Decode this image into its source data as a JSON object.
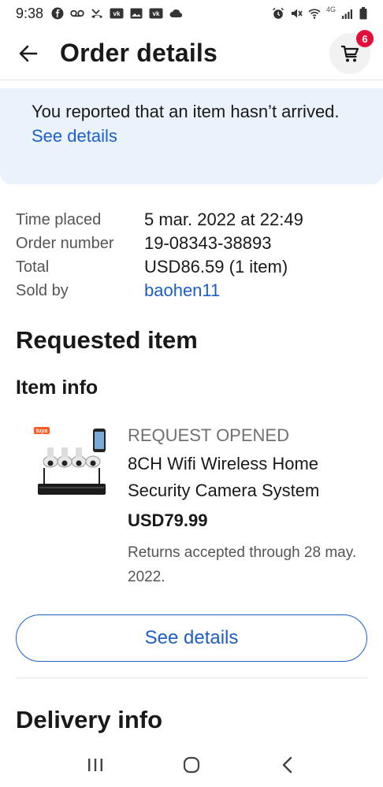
{
  "status_bar": {
    "time": "9:38",
    "left_icons": [
      "facebook-icon",
      "voicemail-icon",
      "missed-call-icon",
      "vk-icon",
      "gallery-icon",
      "vk-icon",
      "cloud-icon"
    ],
    "right_icons": [
      "alarm-icon",
      "mute-icon",
      "wifi-icon",
      "signal-icon",
      "battery-icon"
    ],
    "network": "4G"
  },
  "header": {
    "title": "Order details",
    "cart_count": "6"
  },
  "alert": {
    "message": "You reported that an item hasn’t arrived.",
    "link": "See details"
  },
  "order": {
    "rows": [
      {
        "label": "Time placed",
        "value": "5 mar. 2022 at 22:49"
      },
      {
        "label": "Order number",
        "value": "19-08343-38893"
      },
      {
        "label": "Total",
        "value": "USD86.59 (1 item)"
      },
      {
        "label": "Sold by",
        "value": "baohen11"
      }
    ]
  },
  "requested": {
    "title": "Requested item",
    "subtitle": "Item info",
    "item": {
      "status": "REQUEST OPENED",
      "name": "8CH Wifi Wireless Home Security Camera System",
      "price": "USD79.99",
      "returns": " Returns accepted through 28 may. 2022.",
      "thumb_brand": "tuya"
    },
    "button": "See details"
  },
  "delivery": {
    "title": "Delivery info"
  },
  "colors": {
    "link": "#1d5fc7",
    "alert_bg": "#eaf3fb",
    "badge": "#e0103a"
  }
}
